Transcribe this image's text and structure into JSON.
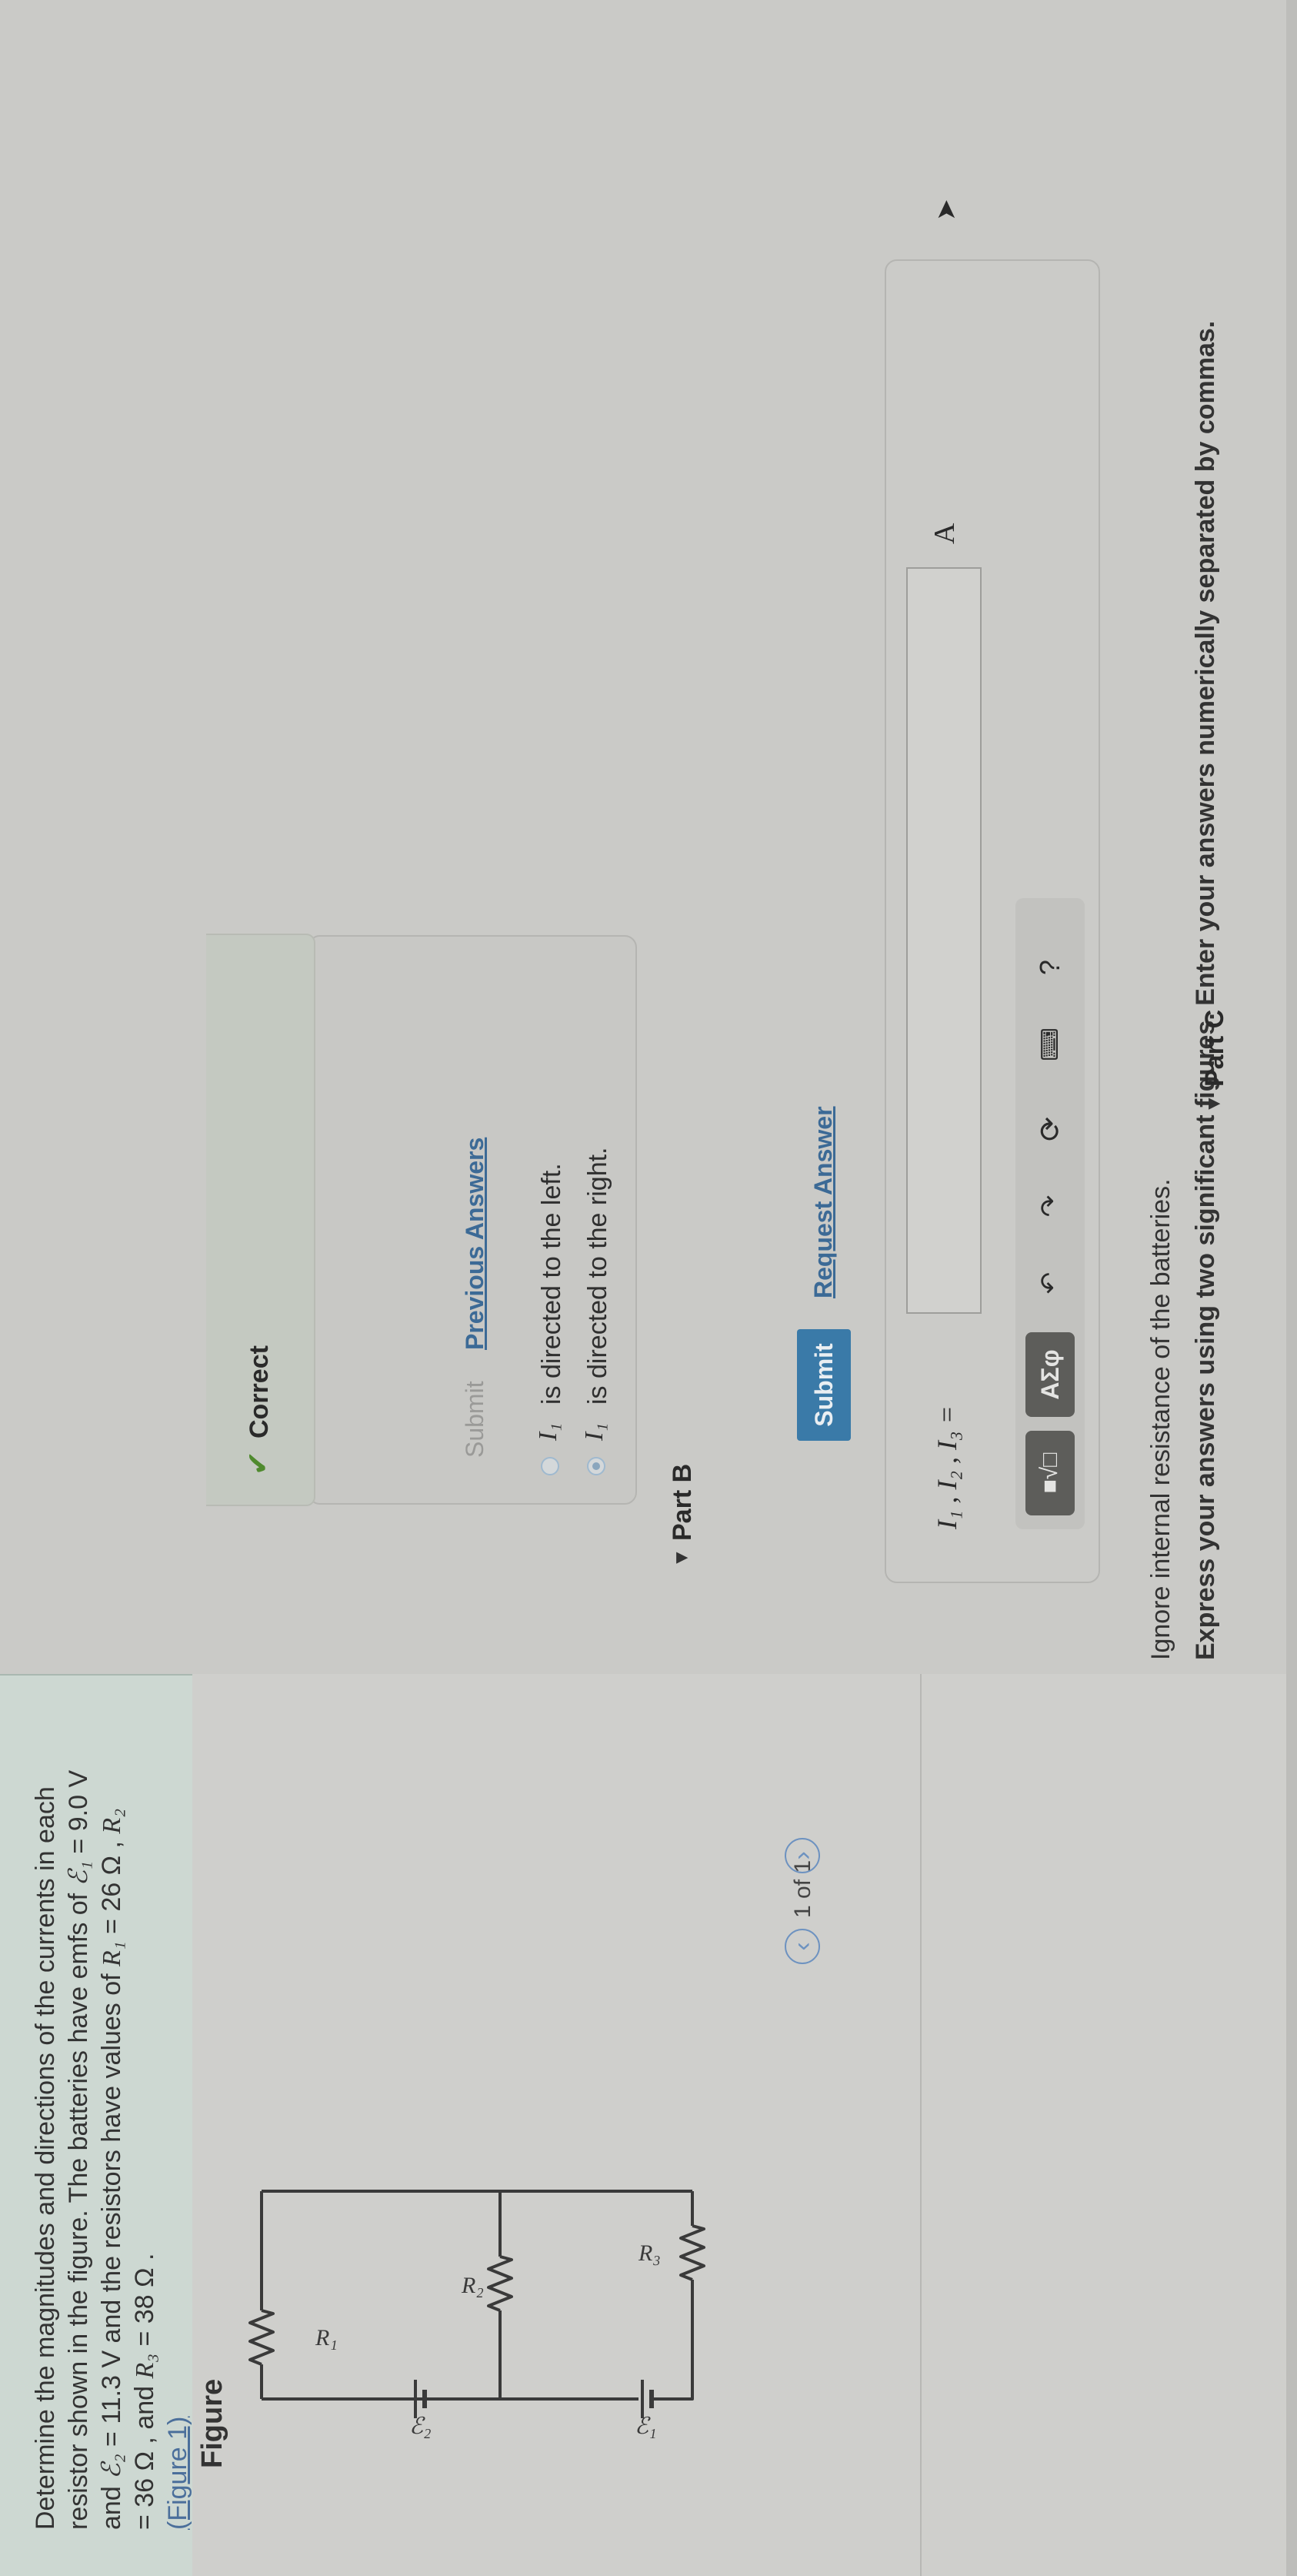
{
  "problem": {
    "line1": "Determine the magnitudes and directions of the currents in each",
    "line2_pre": "resistor shown in the figure. The batteries have emfs of ",
    "e1_sym": "ℰ₁",
    "e1_val": " = 9.0 V",
    "line3_pre": "and ",
    "e2_sym": "ℰ₂",
    "e2_val": " = 11.3 V and the resistors have values of ",
    "r1_sym": "R₁",
    "r1_val": " = 26 Ω , ",
    "r2_sym": "R₂",
    "line4": "= 36 Ω , and ",
    "r3_sym": "R₃",
    "r3_val": " = 38 Ω .",
    "figure_link": "(Figure 1)"
  },
  "figure": {
    "heading": "Figure",
    "labels": {
      "r1": "R₁",
      "r2": "R₂",
      "r3": "R₃",
      "e1": "ℰ₁",
      "e2": "ℰ₂"
    },
    "pager": {
      "prev": "‹",
      "text": "1 of 1",
      "next": "›"
    }
  },
  "part_a": {
    "ignore_text": "Ignore internal resistance of the batteries.",
    "express_text": "Express your answers using two significant figures. Enter your answers numerically separated by commas.",
    "toolbar": {
      "template": "■√□",
      "symbols": "ΑΣφ",
      "undo": "↶",
      "redo": "↷",
      "reset": "⟳",
      "keyboard": "⌨",
      "help": "?"
    },
    "answer_label": "I₁ , I₂ , I₃ =",
    "answer_value": "",
    "unit": "A",
    "submit": "Submit",
    "request_answer": "Request Answer"
  },
  "part_b": {
    "title": "Part B",
    "options": [
      {
        "var": "I₁",
        "text": "is directed to the left."
      },
      {
        "var": "I₁",
        "text": "is directed to the right."
      }
    ],
    "submit": "Submit",
    "previous_answers": "Previous Answers",
    "status": "Correct"
  },
  "part_c": {
    "title": "Part C"
  },
  "colors": {
    "accent": "#3a7aa8",
    "link": "#3c6a96",
    "success": "#4f8a2e"
  }
}
